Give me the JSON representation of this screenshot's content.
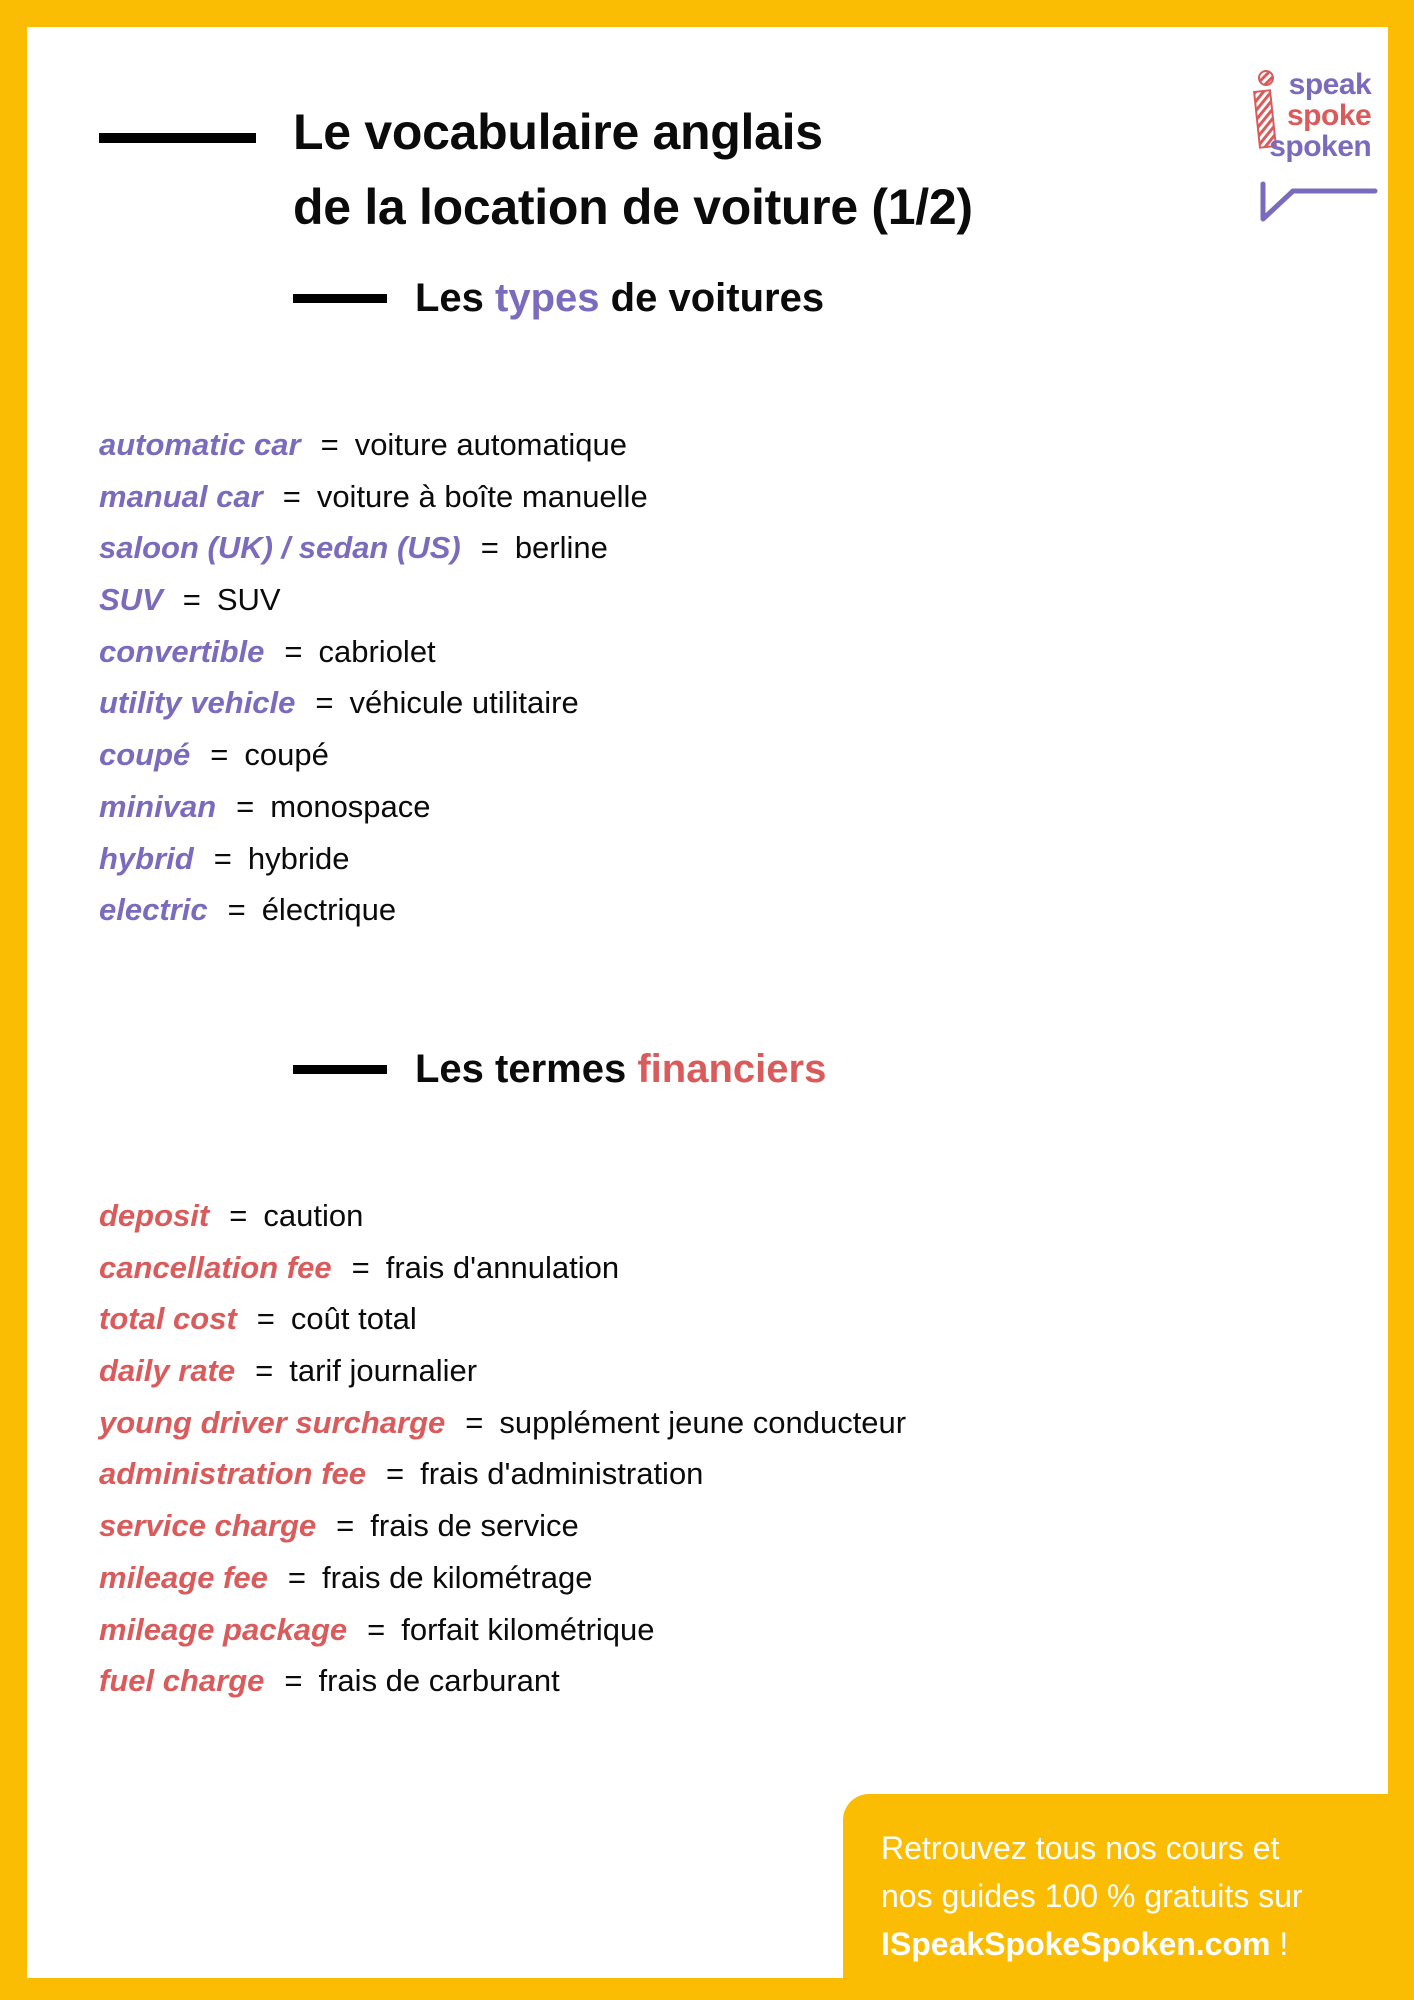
{
  "title": {
    "line1": "Le vocabulaire anglais",
    "line2": "de la location de voiture (1/2)"
  },
  "logo": {
    "icon": "i-pencil-icon",
    "line1": "speak",
    "line2": "spoke",
    "line3": "spoken",
    "colors": {
      "purple": "#7b6bbd",
      "red": "#d95b5b"
    }
  },
  "section_types": {
    "heading_prefix": "Les ",
    "heading_highlight": "types",
    "heading_suffix": " de voitures",
    "items": [
      {
        "en": "automatic car",
        "fr": "voiture automatique"
      },
      {
        "en": "manual car",
        "fr": "voiture à boîte manuelle"
      },
      {
        "en": "saloon (UK) / sedan (US)",
        "fr": "berline"
      },
      {
        "en": "SUV",
        "fr": "SUV"
      },
      {
        "en": "convertible",
        "fr": "cabriolet"
      },
      {
        "en": "utility vehicle",
        "fr": "véhicule utilitaire"
      },
      {
        "en": "coupé",
        "fr": "coupé"
      },
      {
        "en": "minivan",
        "fr": "monospace"
      },
      {
        "en": "hybrid",
        "fr": "hybride"
      },
      {
        "en": "electric",
        "fr": "électrique"
      }
    ]
  },
  "section_finance": {
    "heading_prefix": "Les termes ",
    "heading_highlight": "financiers",
    "items": [
      {
        "en": "deposit",
        "fr": "caution"
      },
      {
        "en": "cancellation fee",
        "fr": "frais d'annulation"
      },
      {
        "en": "total cost",
        "fr": "coût total"
      },
      {
        "en": "daily rate",
        "fr": "tarif journalier"
      },
      {
        "en": "young driver surcharge",
        "fr": "supplément jeune conducteur"
      },
      {
        "en": "administration fee",
        "fr": "frais d'administration"
      },
      {
        "en": "service charge",
        "fr": "frais de service"
      },
      {
        "en": "mileage fee",
        "fr": "frais de kilométrage"
      },
      {
        "en": "mileage package",
        "fr": "forfait kilométrique"
      },
      {
        "en": "fuel charge",
        "fr": "frais de carburant"
      }
    ]
  },
  "separator": "=",
  "footer": {
    "line1": "Retrouvez tous nos cours et",
    "line2": "nos guides 100 % gratuits sur",
    "site": "ISpeakSpokeSpoken.com",
    "suffix": " !"
  },
  "colors": {
    "border": "#FBBC04",
    "purple": "#7b6bbd",
    "red": "#d95b5b"
  }
}
